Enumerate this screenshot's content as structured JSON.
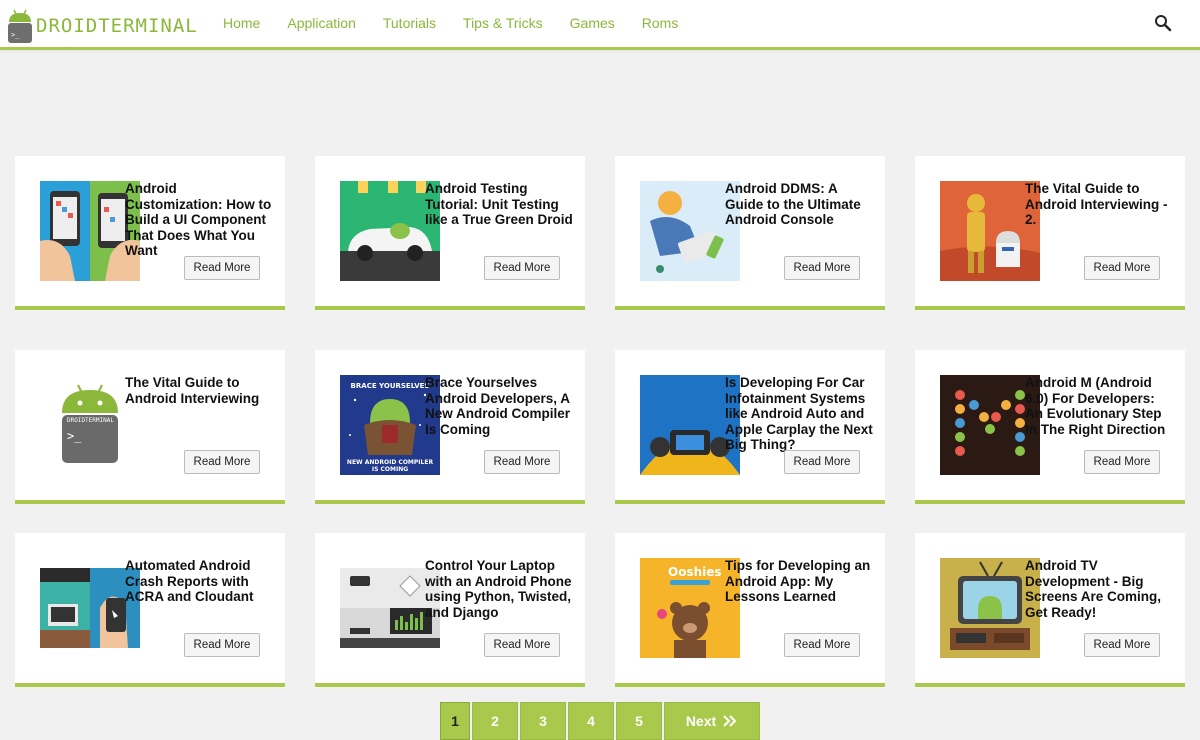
{
  "brand": {
    "name": "DROIDTERMINAL",
    "accent": "#a8c94b"
  },
  "nav": {
    "items": [
      "Home",
      "Application",
      "Tutorials",
      "Tips & Tricks",
      "Games",
      "Roms"
    ],
    "search_icon": "search-icon"
  },
  "cards": [
    {
      "title": "Android Customization: How to Build a UI Component That Does What You Want",
      "read_more": "Read More",
      "thumb": "phones"
    },
    {
      "title": "Android Testing Tutorial: Unit Testing like a True Green Droid",
      "read_more": "Read More",
      "thumb": "car"
    },
    {
      "title": "Android DDMS: A Guide to the Ultimate Android Console",
      "read_more": "Read More",
      "thumb": "desk"
    },
    {
      "title": "The Vital Guide to Android Interviewing - 2.",
      "read_more": "Read More",
      "thumb": "robots"
    },
    {
      "title": "The Vital Guide to Android Interviewing",
      "read_more": "Read More",
      "thumb": "droid-logo"
    },
    {
      "title": "Brace Yourselves Android Developers, A New Android Compiler Is Coming",
      "read_more": "Read More",
      "thumb": "brace"
    },
    {
      "title": "Is Developing For Car Infotainment Systems like Android Auto and Apple Carplay the Next Big Thing?",
      "read_more": "Read More",
      "thumb": "dashboard"
    },
    {
      "title": "Android M (Android 6.0) For Developers: An Evolutionary Step In The Right Direction",
      "read_more": "Read More",
      "thumb": "m-letter"
    },
    {
      "title": "Automated Android Crash Reports with ACRA and Cloudant",
      "read_more": "Read More",
      "thumb": "room"
    },
    {
      "title": "Control Your Laptop with an Android Phone using Python, Twisted, and Django",
      "read_more": "Read More",
      "thumb": "laptop"
    },
    {
      "title": "Tips for Developing an Android App: My Lessons Learned",
      "read_more": "Read More",
      "thumb": "ooshies",
      "thumb_text": "Ooshies"
    },
    {
      "title": "Android TV Development - Big Screens Are Coming, Get Ready!",
      "read_more": "Read More",
      "thumb": "tv"
    }
  ],
  "pagination": {
    "pages": [
      "1",
      "2",
      "3",
      "4",
      "5"
    ],
    "current": "1",
    "next_label": "Next"
  },
  "thumb_texts": {
    "brace_top": "BRACE YOURSELVES",
    "brace_bottom_1": "NEW ANDROID COMPILER",
    "brace_bottom_2": "IS COMING"
  }
}
